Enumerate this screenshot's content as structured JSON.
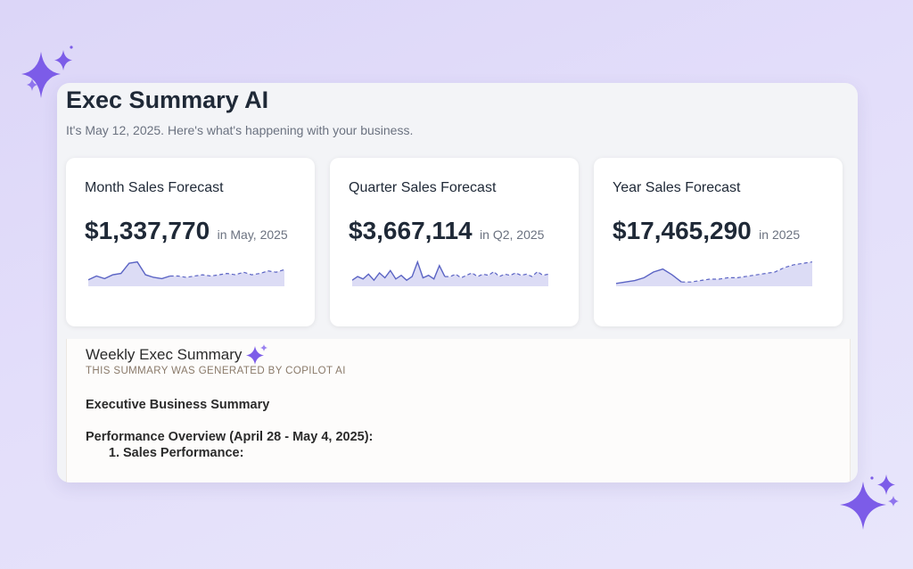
{
  "header": {
    "title": "Exec Summary AI",
    "subtitle": "It's May 12, 2025. Here's what's happening with your business."
  },
  "cards": [
    {
      "title": "Month Sales Forecast",
      "value": "$1,337,770",
      "period": "in May, 2025",
      "trend": {
        "actual": [
          5,
          8,
          6,
          9,
          10,
          18,
          19,
          9,
          7,
          6,
          8
        ],
        "forecast": [
          8,
          7,
          8,
          9,
          8,
          9,
          10,
          9,
          11,
          9,
          10,
          12,
          11,
          13
        ]
      }
    },
    {
      "title": "Quarter Sales Forecast",
      "value": "$3,667,114",
      "period": "in Q2, 2025",
      "trend": {
        "actual": [
          5,
          8,
          6,
          10,
          5,
          11,
          7,
          13,
          6,
          9,
          5,
          8,
          20,
          7,
          9,
          6,
          17,
          8
        ],
        "forecast": [
          8,
          10,
          7,
          9,
          11,
          8,
          10,
          9,
          12,
          8,
          10,
          9,
          11,
          9,
          10,
          8,
          12,
          9,
          10
        ]
      }
    },
    {
      "title": "Year Sales Forecast",
      "value": "$17,465,290",
      "period": "in 2025",
      "trend": {
        "actual": [
          2,
          3,
          4,
          6,
          10,
          12,
          8,
          3
        ],
        "forecast": [
          3,
          4,
          5,
          5,
          6,
          6,
          7,
          8,
          9,
          10,
          13,
          15,
          16,
          17
        ]
      }
    }
  ],
  "summary": {
    "heading": "Weekly Exec Summary",
    "caption": "THIS SUMMARY WAS GENERATED BY COPILOT AI",
    "section_title": "Executive Business Summary",
    "overview_title": "Performance Overview (April 28 - May 4, 2025):",
    "list_items": [
      "Sales Performance:"
    ]
  },
  "colors": {
    "accent": "#6b4fe0",
    "sparkline_stroke": "#5b64c4",
    "sparkline_fill": "#dcdcf5",
    "sparkle": "#7c5ce8"
  },
  "icons": [
    "sparkle-icon"
  ]
}
